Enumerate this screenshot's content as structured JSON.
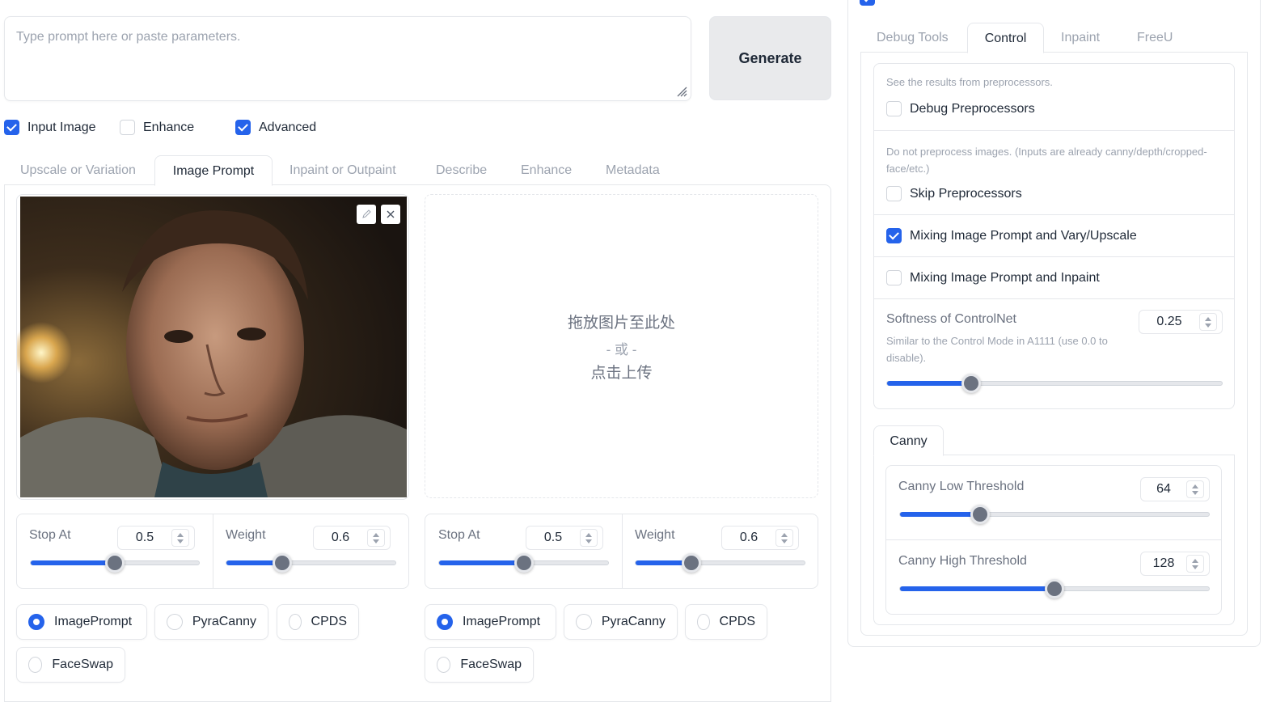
{
  "prompt": {
    "placeholder": "Type prompt here or paste parameters."
  },
  "generate_label": "Generate",
  "options": [
    {
      "label": "Input Image",
      "checked": true
    },
    {
      "label": "Enhance",
      "checked": false
    },
    {
      "label": "Advanced",
      "checked": true
    }
  ],
  "main_tabs": [
    "Upscale or Variation",
    "Image Prompt",
    "Inpaint or Outpaint",
    "Describe",
    "Enhance",
    "Metadata"
  ],
  "upload": {
    "line1": "拖放图片至此处",
    "line2": "- 或 -",
    "line3": "点击上传"
  },
  "panels": [
    {
      "stop_at": {
        "label": "Stop At",
        "value": "0.5",
        "fraction": 0.5
      },
      "weight": {
        "label": "Weight",
        "value": "0.6",
        "fraction": 0.33
      },
      "types": [
        "ImagePrompt",
        "PyraCanny",
        "CPDS",
        "FaceSwap"
      ],
      "selected": "ImagePrompt"
    },
    {
      "stop_at": {
        "label": "Stop At",
        "value": "0.5",
        "fraction": 0.5
      },
      "weight": {
        "label": "Weight",
        "value": "0.6",
        "fraction": 0.33
      },
      "types": [
        "ImagePrompt",
        "PyraCanny",
        "CPDS",
        "FaceSwap"
      ],
      "selected": "ImagePrompt"
    }
  ],
  "right": {
    "tabs": [
      "Debug Tools",
      "Control",
      "Inpaint",
      "FreeU"
    ],
    "active_tab": "Control",
    "debug_desc": "See the results from preprocessors.",
    "debug_label": "Debug Preprocessors",
    "skip_desc": "Do not preprocess images. (Inputs are already canny/depth/cropped-face/etc.)",
    "skip_label": "Skip Preprocessors",
    "mix_vary_label": "Mixing Image Prompt and Vary/Upscale",
    "mix_inpaint_label": "Mixing Image Prompt and Inpaint",
    "softness": {
      "label": "Softness of ControlNet",
      "value": "0.25",
      "desc": "Similar to the Control Mode in A1111 (use 0.0 to disable).",
      "fraction": 0.25
    },
    "canny_tab": "Canny",
    "canny_low": {
      "label": "Canny Low Threshold",
      "value": "64",
      "fraction": 0.26
    },
    "canny_high": {
      "label": "Canny High Threshold",
      "value": "128",
      "fraction": 0.5
    }
  },
  "colors": {
    "accent": "#2563eb"
  }
}
